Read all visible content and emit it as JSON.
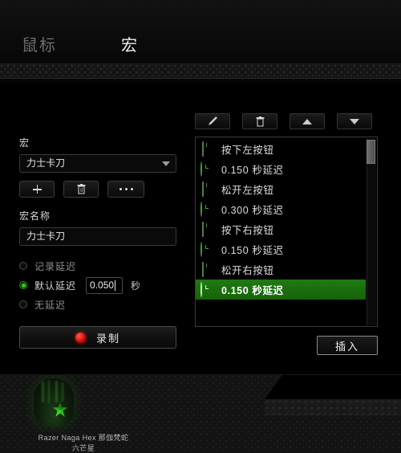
{
  "tabs": [
    {
      "label": "鼠标",
      "active": false,
      "name": "tab-mouse"
    },
    {
      "label": "宏",
      "active": true,
      "name": "tab-macro"
    }
  ],
  "left_panel": {
    "macro_label": "宏",
    "macro_select_value": "力士卡刀",
    "buttons": {
      "add": "+",
      "delete": "trash-icon",
      "more": "..."
    },
    "name_label": "宏名称",
    "name_value": "力士卡刀",
    "delay_options": [
      {
        "label": "记录延迟",
        "selected": false
      },
      {
        "label": "默认延迟",
        "selected": true
      },
      {
        "label": "无延迟",
        "selected": false
      }
    ],
    "delay_value": "0.050",
    "delay_unit": "秒",
    "record_label": "录制"
  },
  "right_panel": {
    "toolbar": [
      {
        "name": "edit-button",
        "icon": "pencil-icon"
      },
      {
        "name": "delete-button",
        "icon": "trash-icon"
      },
      {
        "name": "move-up-button",
        "icon": "arrow-up-icon"
      },
      {
        "name": "move-down-button",
        "icon": "arrow-down-icon"
      }
    ],
    "list": [
      {
        "icon": "mouse-icon",
        "label": "按下左按钮",
        "selected": false
      },
      {
        "icon": "clock-icon",
        "label": "0.150 秒延迟",
        "selected": false
      },
      {
        "icon": "mouse-icon",
        "label": "松开左按钮",
        "selected": false
      },
      {
        "icon": "clock-icon",
        "label": "0.300 秒延迟",
        "selected": false
      },
      {
        "icon": "mouse-icon",
        "label": "按下右按钮",
        "selected": false
      },
      {
        "icon": "clock-icon",
        "label": "0.150 秒延迟",
        "selected": false
      },
      {
        "icon": "mouse-icon",
        "label": "松开右按钮",
        "selected": false
      },
      {
        "icon": "clock-icon",
        "label": "0.150 秒延迟",
        "selected": true
      }
    ],
    "insert_label": "插入"
  },
  "device": {
    "name_line1": "Razer Naga Hex 那伽梵蛇",
    "name_line2": "六芒星"
  },
  "colors": {
    "accent_green": "#2ecc18",
    "selection_green": "#1f7a12",
    "record_red": "#d40000",
    "panel_black": "#000000"
  }
}
